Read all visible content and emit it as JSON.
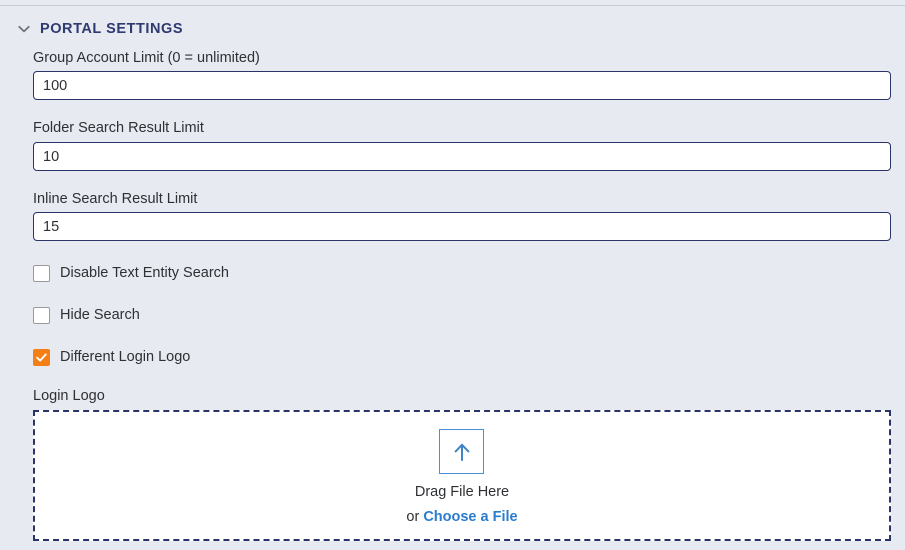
{
  "section": {
    "title": "PORTAL SETTINGS",
    "collapse_icon": "chevron-down-icon",
    "expanded": true
  },
  "fields": [
    {
      "label": "Group Account Limit (0 = unlimited)",
      "value": "100",
      "placeholder": ""
    },
    {
      "label": "Folder Search Result Limit",
      "value": "10",
      "placeholder": ""
    },
    {
      "label": "Inline Search Result Limit",
      "value": "15",
      "placeholder": ""
    }
  ],
  "checkboxes": [
    {
      "label": "Disable Text Entity Search",
      "checked": false
    },
    {
      "label": "Hide Search",
      "checked": false
    },
    {
      "label": "Different Login Logo",
      "checked": true
    }
  ],
  "upload": {
    "label": "Login Logo",
    "icon": "upload-arrow-icon",
    "drag_text": "Drag File Here",
    "or_text": "or ",
    "choose_link": "Choose a File"
  },
  "colors": {
    "background": "#e8eaf2",
    "section_title": "#2e3a70",
    "input_border": "#2b3468",
    "checkbox_checked": "#f57f17",
    "link": "#2a7ccc",
    "arrow_blue": "#4a90d9",
    "dashed_border": "#2b3468",
    "text": "#2e3033"
  }
}
